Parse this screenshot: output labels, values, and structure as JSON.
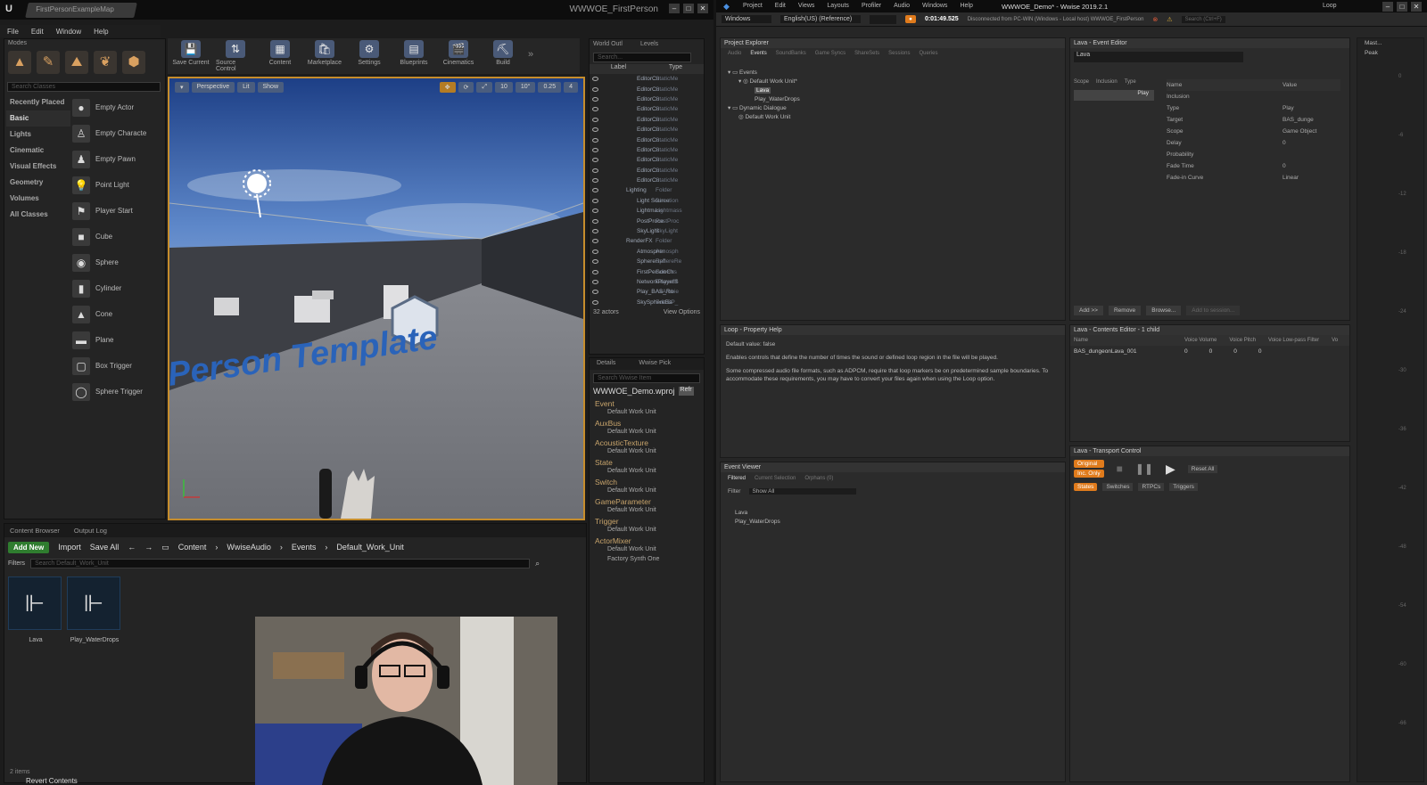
{
  "ue": {
    "window_tab": "FirstPersonExampleMap",
    "window_title": "WWWOE_FirstPerson",
    "menu": [
      "File",
      "Edit",
      "Window",
      "Help"
    ],
    "modes_label": "Modes",
    "search_classes": "Search Classes",
    "categories": [
      "Recently Placed",
      "Basic",
      "Lights",
      "Cinematic",
      "Visual Effects",
      "Geometry",
      "Volumes",
      "All Classes"
    ],
    "place_items": [
      "Empty Actor",
      "Empty Characte",
      "Empty Pawn",
      "Point Light",
      "Player Start",
      "Cube",
      "Sphere",
      "Cylinder",
      "Cone",
      "Plane",
      "Box Trigger",
      "Sphere Trigger"
    ],
    "toolbar": [
      "Save Current",
      "Source Control",
      "Content",
      "Marketplace",
      "Settings",
      "Blueprints",
      "Cinematics",
      "Build"
    ],
    "viewport": {
      "perspective": "Perspective",
      "lit": "Lit",
      "show": "Show",
      "grid_snap": "10",
      "rot_snap": "10°",
      "scale_snap": "0.25",
      "cam_speed": "4",
      "floor_text": "Person Template"
    },
    "outliner": {
      "tabs": [
        "World Outl",
        "Levels"
      ],
      "search": "Search...",
      "col_label": "Label",
      "col_type": "Type",
      "rows": [
        [
          "EditorCu",
          "StaticMe"
        ],
        [
          "EditorCu",
          "StaticMe"
        ],
        [
          "EditorCu",
          "StaticMe"
        ],
        [
          "EditorCu",
          "StaticMe"
        ],
        [
          "EditorCu",
          "StaticMe"
        ],
        [
          "EditorCu",
          "StaticMe"
        ],
        [
          "EditorCu",
          "StaticMe"
        ],
        [
          "EditorCu",
          "StaticMe"
        ],
        [
          "EditorCu",
          "StaticMe"
        ],
        [
          "EditorCu",
          "StaticMe"
        ],
        [
          "EditorCu",
          "StaticMe"
        ],
        [
          "Lighting",
          "Folder"
        ],
        [
          "Light Source",
          "Direction"
        ],
        [
          "Lightmass",
          "Lightmass"
        ],
        [
          "PostProce",
          "PostProc"
        ],
        [
          "SkyLight",
          "SkyLight"
        ],
        [
          "RenderFX",
          "Folder"
        ],
        [
          "Atmospher",
          "Atmosph"
        ],
        [
          "SphereRefl",
          "SphereRe"
        ],
        [
          "FirstPersonCh",
          "Edit Firs"
        ],
        [
          "NetworkPlayerS",
          "PlayerSt"
        ],
        [
          "Play_BAS_Ru",
          "AkAmbie"
        ],
        [
          "SkySphereBa",
          "Edit BP_"
        ]
      ],
      "actors": "32 actors",
      "view_options": "View Options"
    },
    "details": {
      "tabs": [
        "Details",
        "Wwise Pick"
      ],
      "search": "Search Wwise Item",
      "project": "WWWOE_Demo.wproj",
      "refresh": "Refr",
      "tree": [
        {
          "name": "Event",
          "child": "Default Work Unit"
        },
        {
          "name": "AuxBus",
          "child": "Default Work Unit"
        },
        {
          "name": "AcousticTexture",
          "child": "Default Work Unit"
        },
        {
          "name": "State",
          "child": "Default Work Unit"
        },
        {
          "name": "Switch",
          "child": "Default Work Unit"
        },
        {
          "name": "GameParameter",
          "child": "Default Work Unit"
        },
        {
          "name": "Trigger",
          "child": "Default Work Unit"
        },
        {
          "name": "ActorMixer",
          "child": "Default Work Unit"
        }
      ],
      "extra": "Factory Synth One"
    },
    "content_browser": {
      "tabs": [
        "Content Browser",
        "Output Log"
      ],
      "add_new": "Add New",
      "import": "Import",
      "save_all": "Save All",
      "path": [
        "Content",
        "WwiseAudio",
        "Events",
        "Default_Work_Unit"
      ],
      "filters": "Filters",
      "search": "Search Default_Work_Unit",
      "assets": [
        "Lava",
        "Play_WaterDrops"
      ],
      "count": "2 items",
      "revert": "Revert Contents"
    }
  },
  "wwise": {
    "menu": [
      "Project",
      "Edit",
      "Views",
      "Layouts",
      "Profiler",
      "Audio",
      "Windows",
      "Help"
    ],
    "title": "WWWOE_Demo* - Wwise 2019.2.1",
    "layout_label": "Loop",
    "platform": "Windows",
    "language": "English(US) (Reference)",
    "time": "0:01:49.525",
    "connection": "Disconnected from PC-WIN (Windows - Local host) WWWOE_FirstPerson",
    "search": "Search (Ctrl+F)",
    "explorer": {
      "title": "Project Explorer",
      "tabs": [
        "Audio",
        "Events",
        "SoundBanks",
        "Game Syncs",
        "ShareSets",
        "Sessions",
        "Queries"
      ],
      "tree": [
        "Events",
        "Default Work Unit*",
        "Lava",
        "Play_WaterDrops",
        "Dynamic Dialogue",
        "Default Work Unit"
      ]
    },
    "event_editor": {
      "title": "Lava - Event Editor",
      "name": "Lava",
      "cols": [
        "Scope",
        "Inclusion",
        "Type"
      ],
      "action": "Play",
      "props": [
        [
          "Name",
          "Value"
        ],
        [
          "Inclusion",
          ""
        ],
        [
          "Type",
          "Play"
        ],
        [
          "Target",
          "BAS_dunge"
        ],
        [
          "Scope",
          "Game Object"
        ],
        [
          "Delay",
          "0"
        ],
        [
          "Probability",
          ""
        ],
        [
          "Fade Time",
          "0"
        ],
        [
          "Fade-in Curve",
          "Linear"
        ]
      ],
      "buttons": [
        "Add >>",
        "Remove",
        "Browse...",
        "Add to session..."
      ]
    },
    "help": {
      "title": "Loop - Property Help",
      "default": "Default value: false",
      "text1": "Enables controls that define the number of times the sound or defined loop region in the file will be played.",
      "text2": "Some compressed audio file formats, such as ADPCM, require that loop markers be on predetermined sample boundaries. To accommodate these requirements, you may have to convert your files again when using the Loop option."
    },
    "contents": {
      "title": "Lava - Contents Editor - 1 child",
      "cols": [
        "Name",
        "Voice Volume",
        "Voice Pitch",
        "Voice Low-pass Filter",
        "Vo"
      ],
      "row": "BAS_dungeonLava_001",
      "vals": [
        "0",
        "0",
        "0",
        "0"
      ]
    },
    "event_viewer": {
      "title": "Event Viewer",
      "tabs": [
        "Filtered",
        "Current Selection",
        "Orphans (0)"
      ],
      "filter": "Filter",
      "show_all": "Show All",
      "items": [
        "Lava",
        "Play_WaterDrops"
      ]
    },
    "transport": {
      "title": "Lava - Transport Control",
      "original": "Original",
      "inc_only": "Inc. Only",
      "reset_all": "Reset All",
      "tabs": [
        "States",
        "Switches",
        "RTPCs",
        "Triggers"
      ]
    },
    "meter": {
      "label": "Mast...",
      "peak": "Peak",
      "ticks": [
        "0",
        "-6",
        "-12",
        "-18",
        "-24",
        "-30",
        "-36",
        "-42",
        "-48",
        "-54",
        "-60",
        "-66"
      ]
    }
  },
  "colors": {
    "accent": "#e07b1c",
    "ue_border": "#c68d2c",
    "add_new": "#2f7d2f"
  }
}
